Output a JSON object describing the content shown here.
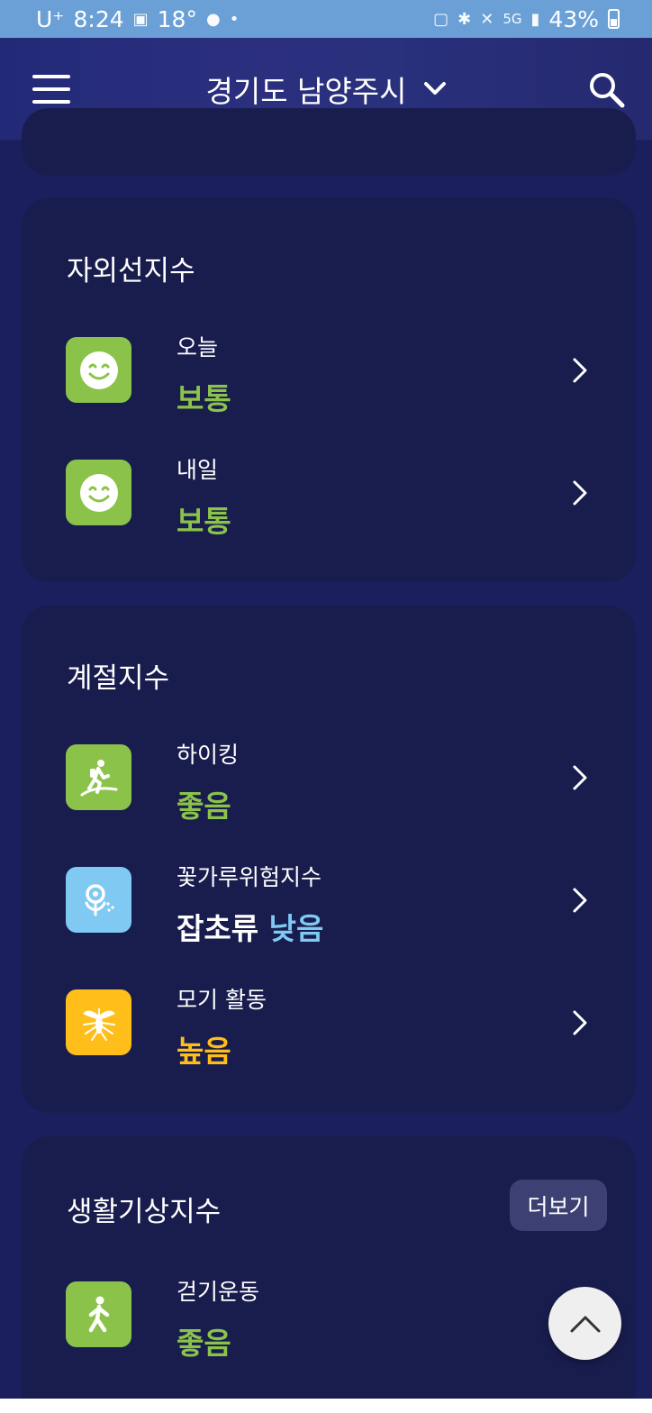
{
  "status_bar": {
    "carrier": "U⁺",
    "time": "8:24",
    "temp": "18°",
    "network": "5G",
    "battery": "43%"
  },
  "header": {
    "location": "경기도 남양주시",
    "icons": [
      "menu-icon",
      "chevron-down-icon",
      "search-icon"
    ]
  },
  "uv": {
    "title": "자외선지수",
    "rows": [
      {
        "label": "오늘",
        "value": "보통",
        "icon": "smile-icon",
        "color": "#8bc34a"
      },
      {
        "label": "내일",
        "value": "보통",
        "icon": "smile-icon",
        "color": "#8bc34a"
      }
    ]
  },
  "seasonal": {
    "title": "계절지수",
    "rows": [
      {
        "label": "하이킹",
        "value": "좋음",
        "icon": "hiking-icon",
        "color": "#8bc34a"
      },
      {
        "label": "꽃가루위험지수",
        "value_prefix": "잡초류",
        "value": "낮음",
        "icon": "pollen-flower-icon",
        "color": "#7fc9f2"
      },
      {
        "label": "모기 활동",
        "value": "높음",
        "icon": "mosquito-icon",
        "color": "#ffbe1a"
      }
    ]
  },
  "living": {
    "title": "생활기상지수",
    "more_label": "더보기",
    "rows": [
      {
        "label": "걷기운동",
        "value": "좋음",
        "icon": "walking-icon",
        "color": "#8bc34a"
      }
    ]
  },
  "colors": {
    "background": "#1b1f5e",
    "card": "#191d4e",
    "good": "#8bc34a",
    "low": "#7fc9f2",
    "high": "#ffbe1a"
  }
}
